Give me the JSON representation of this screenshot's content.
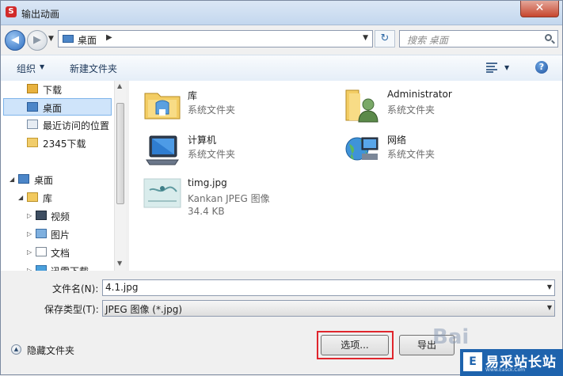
{
  "window": {
    "title": "输出动画",
    "close_glyph": "✕"
  },
  "nav": {
    "address_location": "桌面",
    "search_placeholder": "搜索 桌面"
  },
  "toolbar": {
    "organize_label": "组织",
    "new_folder_label": "新建文件夹"
  },
  "sidebar": {
    "items": [
      {
        "label": "下载",
        "icon": "download-folder-icon"
      },
      {
        "label": "桌面",
        "icon": "desktop-icon",
        "selected": true
      },
      {
        "label": "最近访问的位置",
        "icon": "recent-places-icon"
      },
      {
        "label": "2345下载",
        "icon": "folder-icon"
      },
      {
        "label": "桌面",
        "icon": "desktop-icon"
      },
      {
        "label": "库",
        "icon": "library-icon"
      },
      {
        "label": "视频",
        "icon": "video-library-icon"
      },
      {
        "label": "图片",
        "icon": "pictures-library-icon"
      },
      {
        "label": "文档",
        "icon": "documents-library-icon"
      },
      {
        "label": "迅雷下载",
        "icon": "thunder-download-icon"
      }
    ]
  },
  "content": {
    "items": [
      {
        "name": "库",
        "type": "系统文件夹",
        "icon": "library-icon"
      },
      {
        "name": "Administrator",
        "type": "系统文件夹",
        "icon": "user-folder-icon"
      },
      {
        "name": "计算机",
        "type": "系统文件夹",
        "icon": "computer-icon"
      },
      {
        "name": "网络",
        "type": "系统文件夹",
        "icon": "network-icon"
      },
      {
        "name": "timg.jpg",
        "type": "Kankan JPEG 图像",
        "size": "34.4 KB",
        "icon": "image-thumbnail-icon"
      }
    ]
  },
  "fields": {
    "filename_label": "文件名(N):",
    "filename_value": "4.1.jpg",
    "filetype_label": "保存类型(T):",
    "filetype_value": "JPEG 图像 (*.jpg)"
  },
  "footer": {
    "hide_folders_label": "隐藏文件夹",
    "options_button": "选项...",
    "export_button": "导出"
  },
  "watermark": {
    "site": "易采站长站",
    "baidu": "Bai",
    "logo": "E",
    "url": "Www.Easck.Com"
  },
  "colors": {
    "highlight": "#e0262d",
    "selection": "#cfe4fa",
    "accent": "#1e63ad"
  }
}
